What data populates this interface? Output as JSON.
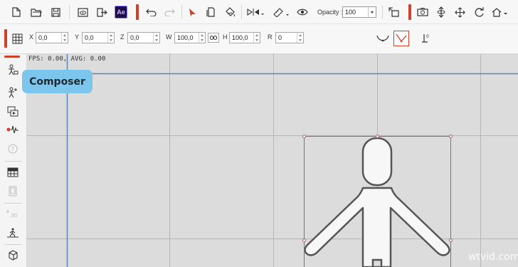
{
  "toolbar": {
    "opacity_label": "Opacity :",
    "opacity_value": "100",
    "ae_label": "Ae",
    "accent_color": "#d03e2c",
    "icons": [
      "new-file-icon",
      "open-folder-icon",
      "save-icon",
      "preview-icon",
      "export-icon",
      "after-effects-icon",
      "undo-icon",
      "redo-icon",
      "select-arrow-icon",
      "copy-icon",
      "paint-bucket-icon",
      "flip-icon",
      "ruler-icon",
      "eye-icon",
      "anchor-icon",
      "camera-icon",
      "move-vertical-icon",
      "move-icon",
      "rotate-icon",
      "home-icon"
    ]
  },
  "transform": {
    "x_label": "X",
    "x_value": "0,0",
    "y_label": "Y",
    "y_value": "0,0",
    "z_label": "Z",
    "z_value": "0,0",
    "w_label": "W",
    "w_value": "100,0",
    "h_label": "H",
    "h_value": "100,0",
    "r_label": "R",
    "r_value": "0"
  },
  "sidebar": {
    "icons": [
      "composer-icon",
      "character-add-icon",
      "scene-icon",
      "audio-wave-icon",
      "help-icon",
      "grid-panel-icon",
      "phone-icon",
      "text-3d-icon",
      "walk-icon",
      "box-icon"
    ]
  },
  "canvas": {
    "fps_text": "FPS: 0.00, AVG: 0.00",
    "background": "#dcdcdc"
  },
  "tooltip": {
    "label": "Composer",
    "color": "#7cc6ee"
  },
  "watermark": "wtvid.com"
}
